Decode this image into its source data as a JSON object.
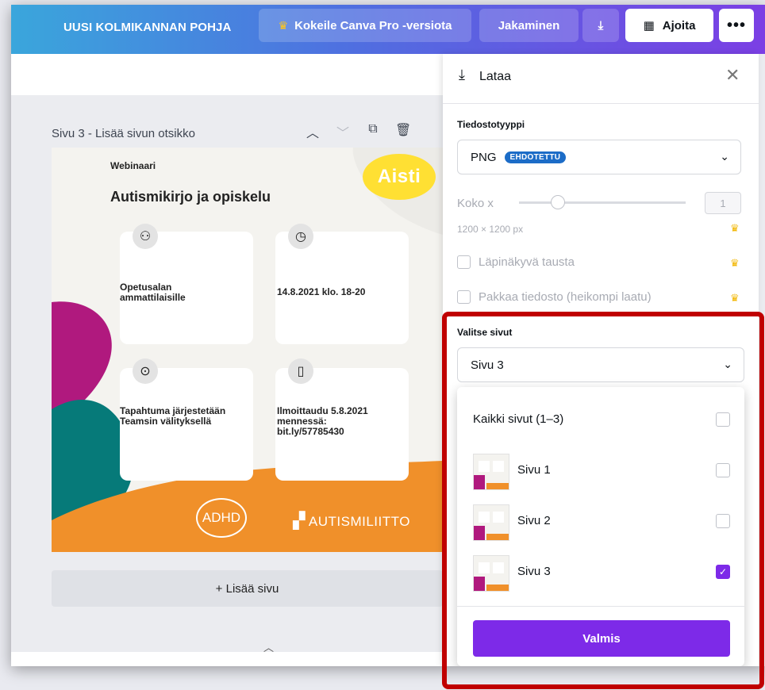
{
  "topbar": {
    "title": "UUSI KOLMIKANNAN POHJA",
    "pro_label": "Kokeile Canva Pro -versiota",
    "share_label": "Jakaminen",
    "schedule_label": "Ajoita",
    "more_label": "•••",
    "download_icon": "download-icon",
    "crown_icon": "crown-icon",
    "calendar_icon": "calendar-icon"
  },
  "editor": {
    "page_label": "Sivu 3 - Lisää sivun otsikko",
    "add_page_label": "+ Lisää sivu"
  },
  "design": {
    "kicker": "Webinaari",
    "title": "Autismikirjo ja opiskelu",
    "cards": [
      {
        "text": "Opetusalan ammattilaisille",
        "icon": "user-check-icon"
      },
      {
        "text": "14.8.2021 klo. 18-20",
        "icon": "clock-icon"
      },
      {
        "text": "Tapahtuma järjestetään Teamsin välityksellä",
        "icon": "location-pin-icon"
      },
      {
        "text": "Ilmoittaudu 5.8.2021 mennessä: bit.ly/57785430",
        "icon": "clipboard-icon"
      }
    ],
    "logo_aisti": "Aisti",
    "logo_adhd": "ADHD",
    "logo_autismiliitto": "AUTISMILIITTO",
    "colors": {
      "magenta": "#b0197e",
      "teal": "#067a79",
      "orange": "#f0902a",
      "yellow": "#ffe033"
    }
  },
  "panel": {
    "title": "Lataa",
    "file_type_label": "Tiedostotyyppi",
    "file_type_value": "PNG",
    "file_type_badge": "EHDOTETTU",
    "size_label": "Koko x",
    "size_value": "1",
    "size_px": "1200 × 1200 px",
    "transparent_label": "Läpinäkyvä tausta",
    "compress_label": "Pakkaa tiedosto (heikompi laatu)",
    "pages_label": "Valitse sivut",
    "pages_value": "Sivu 3"
  },
  "dropdown": {
    "items": [
      {
        "label": "Kaikki sivut (1–3)",
        "checked": false
      },
      {
        "label": "Sivu 1",
        "checked": false
      },
      {
        "label": "Sivu 2",
        "checked": false
      },
      {
        "label": "Sivu 3",
        "checked": true
      }
    ],
    "done_label": "Valmis"
  },
  "colors": {
    "accent": "#7d2ae8",
    "highlight": "#c00000",
    "badge": "#1c6cc7"
  }
}
